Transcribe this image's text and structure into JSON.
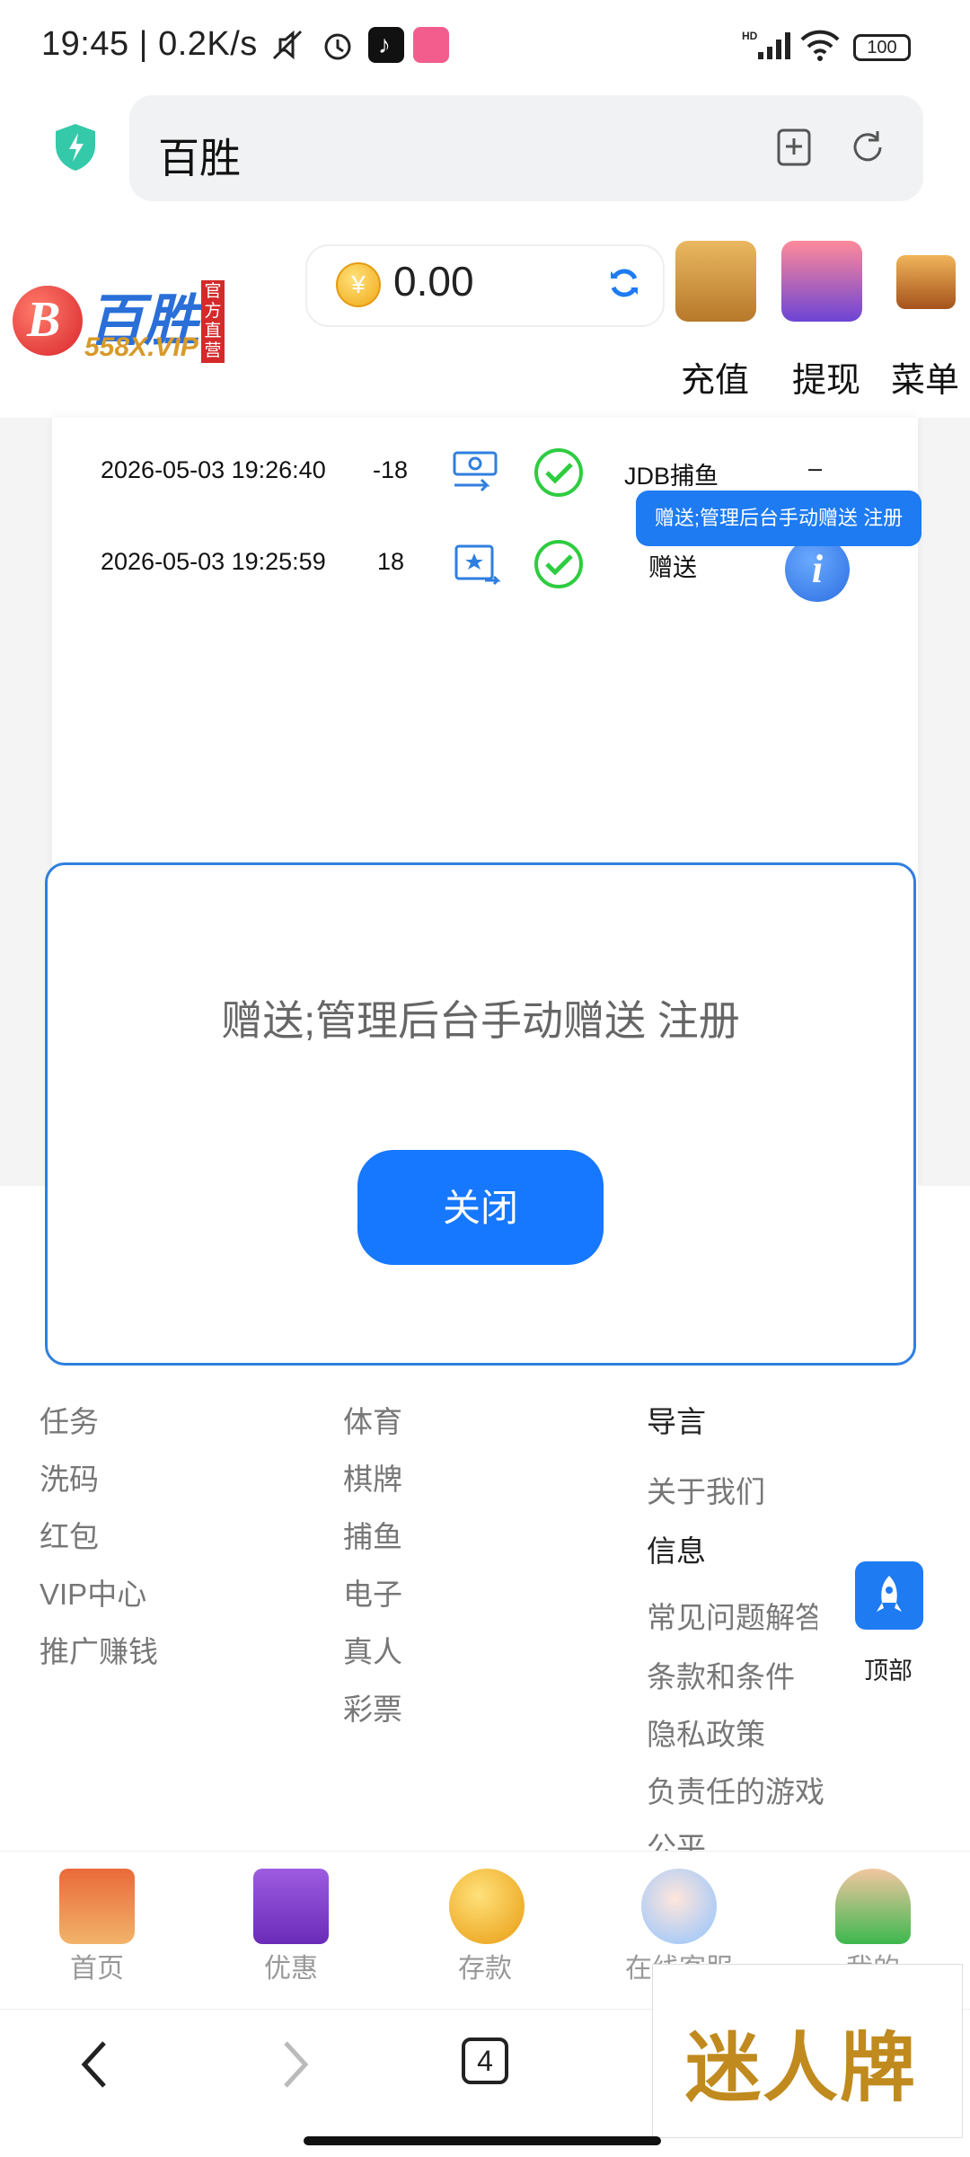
{
  "status_bar": {
    "time_speed": "19:45 | 0.2K/s",
    "battery": "100"
  },
  "browser": {
    "url_title": "百胜",
    "tab_count": "4"
  },
  "site_header": {
    "logo_text": "百胜",
    "logo_sub": "558X.VIP",
    "logo_badge": "官方直营",
    "balance": "0.00",
    "actions": [
      {
        "label": "充值",
        "icon": "wallet-icon"
      },
      {
        "label": "提现",
        "icon": "atm-icon"
      },
      {
        "label": "菜单",
        "icon": "treasure-chest-icon"
      }
    ]
  },
  "records": [
    {
      "datetime": "2026-05-03 19:26:40",
      "amount": "-18",
      "type_icon": "money-transfer-icon",
      "status_icon": "check-circle-icon",
      "game": "JDB捕鱼",
      "extra": "–"
    },
    {
      "datetime": "2026-05-03 19:25:59",
      "amount": "18",
      "type_icon": "gift-transfer-icon",
      "status_icon": "check-circle-icon",
      "game": "赠送",
      "extra": ""
    }
  ],
  "tooltip": "赠送;管理后台手动赠送 注册",
  "modal": {
    "message": "赠送;管理后台手动赠送 注册",
    "close_label": "关闭"
  },
  "footer": {
    "col1": [
      "任务",
      "洗码",
      "红包",
      "VIP中心",
      "推广赚钱"
    ],
    "col2": [
      "体育",
      "棋牌",
      "捕鱼",
      "电子",
      "真人",
      "彩票"
    ],
    "col3_head1": "导言",
    "col3_item1": "关于我们",
    "col3_head2": "信息",
    "col3_items": [
      "常见问题解答",
      "条款和条件",
      "隐私政策",
      "负责任的游戏",
      "公平"
    ],
    "to_top": "顶部"
  },
  "bottom_nav": [
    {
      "label": "首页",
      "icon": "house-icon"
    },
    {
      "label": "优惠",
      "icon": "gift-icon"
    },
    {
      "label": "存款",
      "icon": "coin-deposit-icon"
    },
    {
      "label": "在线客服",
      "icon": "customer-service-icon"
    },
    {
      "label": "我的",
      "icon": "user-icon"
    }
  ],
  "watermark": "迷人牌",
  "colors": {
    "accent": "#1677ff",
    "modal_border": "#2f7fe0",
    "success": "#2ecc40"
  }
}
